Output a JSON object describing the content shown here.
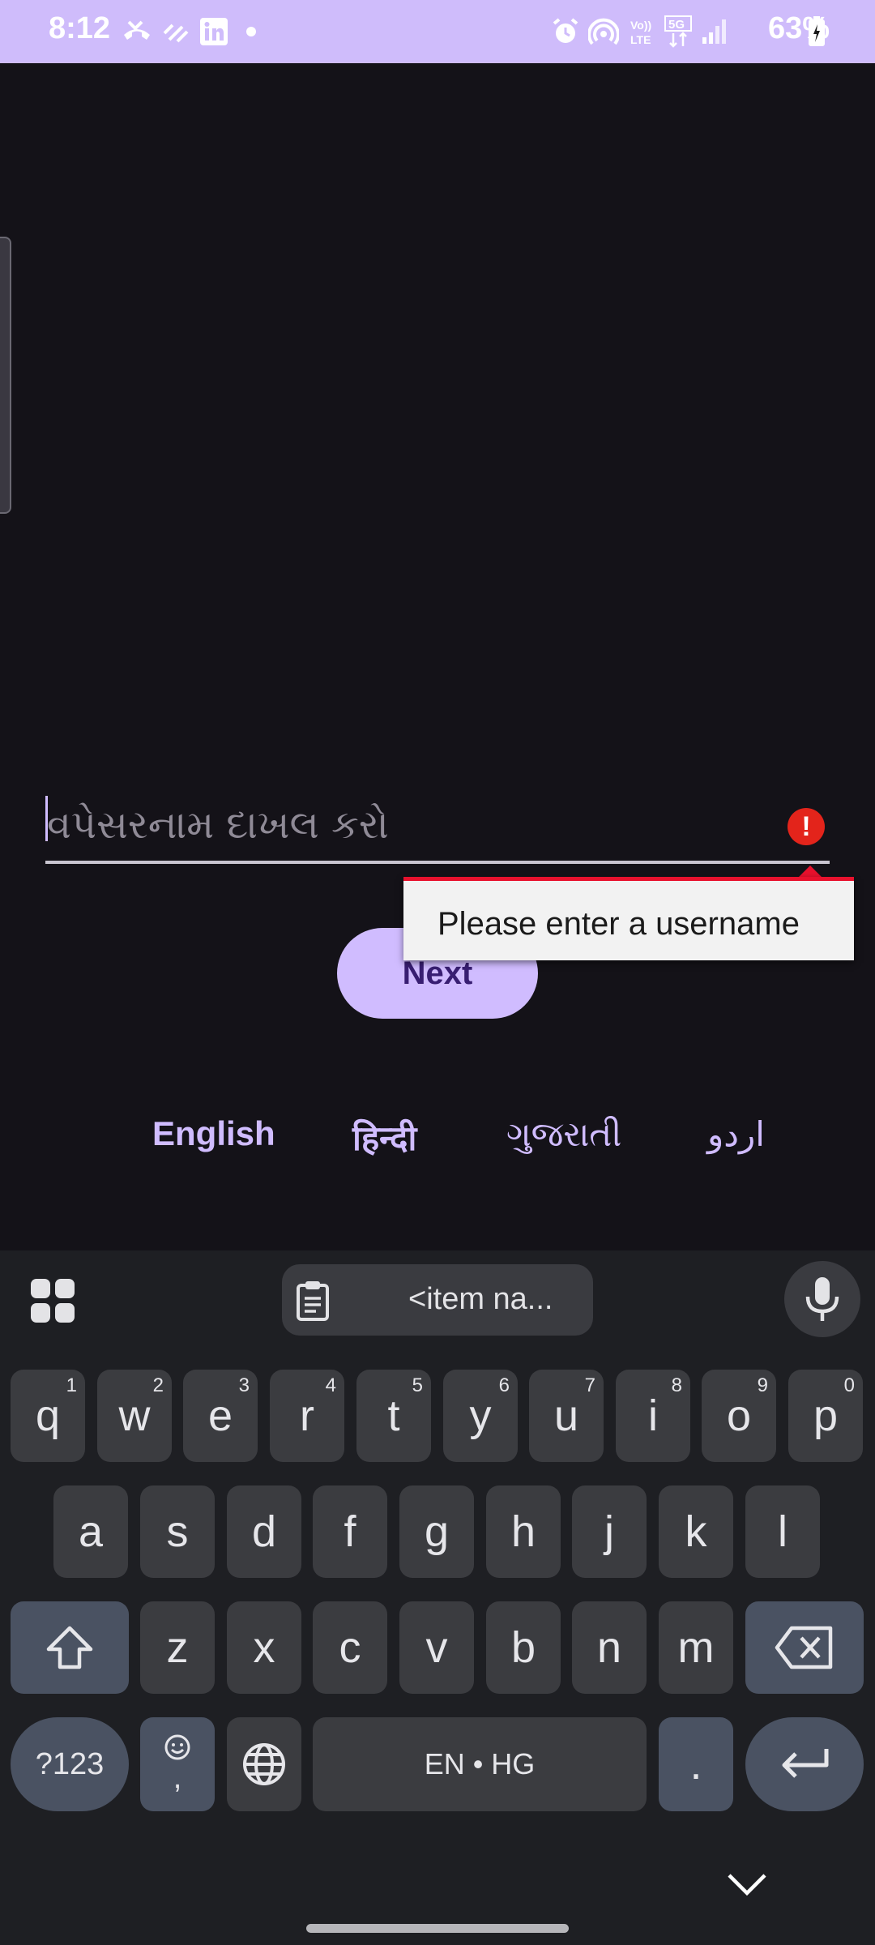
{
  "status_bar": {
    "time": "8:12",
    "battery": "63%"
  },
  "input": {
    "placeholder": "વપેસરનામ દાખલ કરો"
  },
  "error": {
    "message": "Please enter a username"
  },
  "next_button": {
    "label": "Next"
  },
  "languages": [
    "English",
    "हिन्दी",
    "ગુજરાતી",
    "اردو"
  ],
  "keyboard": {
    "clipboard_text": "<item na...",
    "row1": [
      {
        "key": "q",
        "hint": "1"
      },
      {
        "key": "w",
        "hint": "2"
      },
      {
        "key": "e",
        "hint": "3"
      },
      {
        "key": "r",
        "hint": "4"
      },
      {
        "key": "t",
        "hint": "5"
      },
      {
        "key": "y",
        "hint": "6"
      },
      {
        "key": "u",
        "hint": "7"
      },
      {
        "key": "i",
        "hint": "8"
      },
      {
        "key": "o",
        "hint": "9"
      },
      {
        "key": "p",
        "hint": "0"
      }
    ],
    "row2": [
      "a",
      "s",
      "d",
      "f",
      "g",
      "h",
      "j",
      "k",
      "l"
    ],
    "row3": [
      "z",
      "x",
      "c",
      "v",
      "b",
      "n",
      "m"
    ],
    "symbols_label": "?123",
    "emoji_comma_label": ",",
    "space_label": "EN • HG",
    "period_label": "."
  },
  "colors": {
    "accent": "#d0bcff",
    "status_bar": "#cfbcfb",
    "background": "#141218",
    "error": "#e3241b"
  }
}
